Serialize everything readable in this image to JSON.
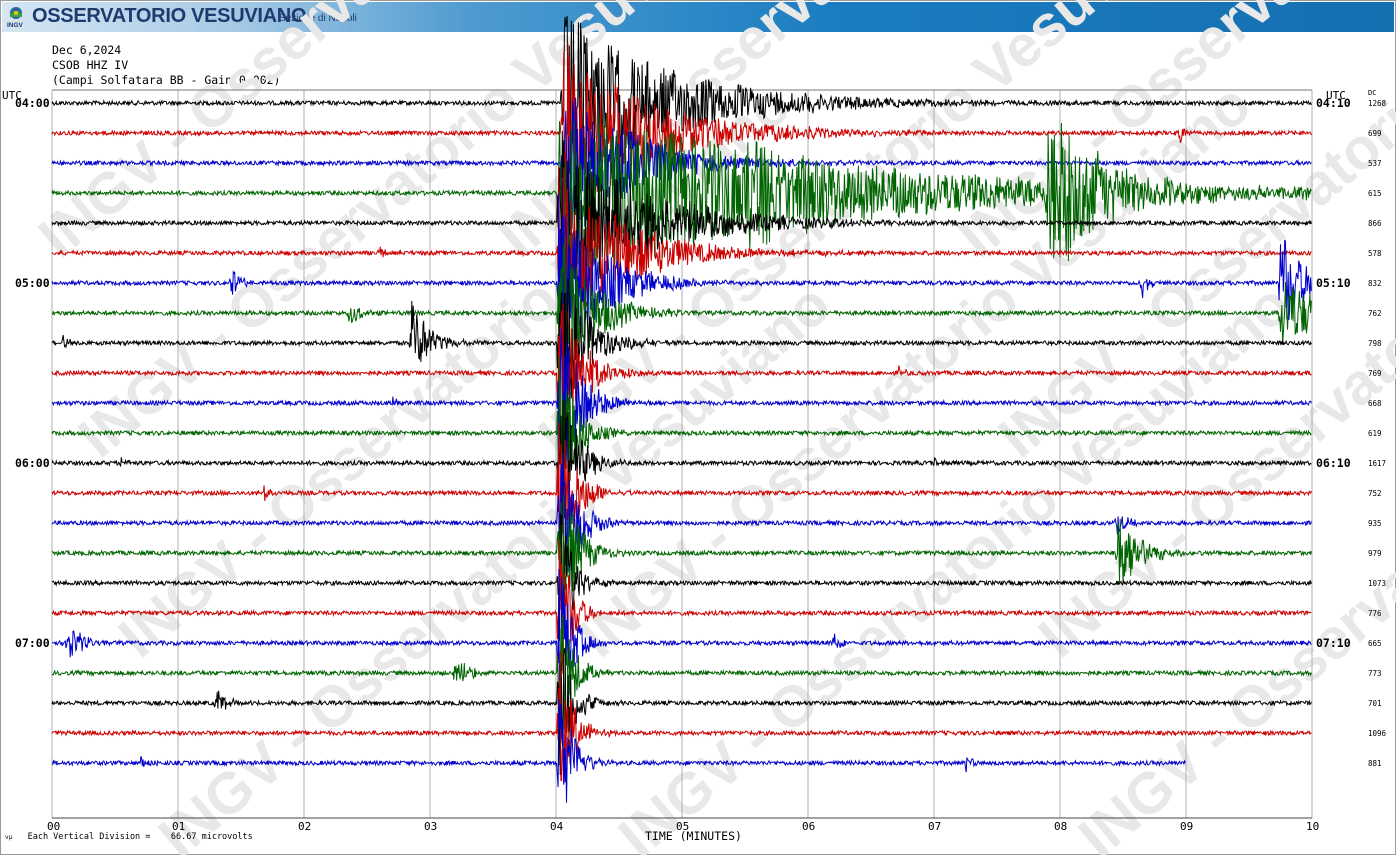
{
  "banner": {
    "title": "OSSERVATORIO VESUVIANO",
    "subtitle": "Sezione di Napoli",
    "logo_text": "INGV"
  },
  "header": {
    "date": "Dec 6,2024",
    "station": "CSOB HHZ IV",
    "description": "(Campi Solfatara BB - Gain 0.002)"
  },
  "watermark": "INGV - Osservatorio Vesuviano",
  "footer": {
    "vertical_division_prefix": "vµ",
    "vertical_division": "Each Vertical Division =    66.67 microvolts"
  },
  "chart_data": {
    "type": "line",
    "title": "",
    "xlabel": "TIME (MINUTES)",
    "x_ticks": [
      "00",
      "01",
      "02",
      "03",
      "04",
      "05",
      "06",
      "07",
      "08",
      "09",
      "10"
    ],
    "xlim": [
      0,
      10
    ],
    "left_axis_title": "UTC",
    "right_axis_title": "UTC",
    "dc_title": "DC",
    "left_time_labels": [
      {
        "line": 0,
        "label": "04:00"
      },
      {
        "line": 6,
        "label": "05:00"
      },
      {
        "line": 12,
        "label": "06:00"
      },
      {
        "line": 18,
        "label": "07:00"
      }
    ],
    "right_time_labels": [
      {
        "line": 0,
        "label": "04:10"
      },
      {
        "line": 6,
        "label": "05:10"
      },
      {
        "line": 12,
        "label": "06:10"
      },
      {
        "line": 18,
        "label": "07:10"
      }
    ],
    "line_minutes": 10,
    "grid": true,
    "colors": [
      "#000000",
      "#cc0000",
      "#0000cc",
      "#006400"
    ],
    "trace_count": 23,
    "last_trace_end_minute": 9.0,
    "dc_offsets": [
      1268,
      699,
      537,
      615,
      866,
      578,
      832,
      762,
      798,
      769,
      668,
      619,
      1617,
      752,
      935,
      979,
      1073,
      776,
      665,
      773,
      701,
      1096,
      881
    ],
    "events": [
      {
        "line": 0,
        "minute": 4.05,
        "amp": 95,
        "decay_s": 50
      },
      {
        "line": 1,
        "minute": 4.05,
        "amp": 95,
        "decay_s": 40
      },
      {
        "line": 2,
        "minute": 4.05,
        "amp": 95,
        "decay_s": 30
      },
      {
        "line": 3,
        "minute": 4.02,
        "amp": 95,
        "decay_s": 120
      },
      {
        "line": 4,
        "minute": 4.02,
        "amp": 95,
        "decay_s": 40
      },
      {
        "line": 5,
        "minute": 4.02,
        "amp": 95,
        "decay_s": 30
      },
      {
        "line": 6,
        "minute": 4.02,
        "amp": 95,
        "decay_s": 20
      },
      {
        "line": 7,
        "minute": 4.02,
        "amp": 95,
        "decay_s": 15
      },
      {
        "line": 8,
        "minute": 4.02,
        "amp": 95,
        "decay_s": 12
      },
      {
        "line": 9,
        "minute": 4.02,
        "amp": 95,
        "decay_s": 10
      },
      {
        "line": 10,
        "minute": 4.02,
        "amp": 95,
        "decay_s": 10
      },
      {
        "line": 11,
        "minute": 4.02,
        "amp": 95,
        "decay_s": 8
      },
      {
        "line": 12,
        "minute": 4.02,
        "amp": 95,
        "decay_s": 8
      },
      {
        "line": 13,
        "minute": 4.02,
        "amp": 95,
        "decay_s": 8
      },
      {
        "line": 14,
        "minute": 4.02,
        "amp": 95,
        "decay_s": 8
      },
      {
        "line": 15,
        "minute": 4.02,
        "amp": 95,
        "decay_s": 8
      },
      {
        "line": 16,
        "minute": 4.02,
        "amp": 95,
        "decay_s": 6
      },
      {
        "line": 17,
        "minute": 4.02,
        "amp": 95,
        "decay_s": 6
      },
      {
        "line": 18,
        "minute": 4.02,
        "amp": 95,
        "decay_s": 6
      },
      {
        "line": 19,
        "minute": 4.02,
        "amp": 95,
        "decay_s": 6
      },
      {
        "line": 20,
        "minute": 4.02,
        "amp": 95,
        "decay_s": 6
      },
      {
        "line": 21,
        "minute": 4.02,
        "amp": 95,
        "decay_s": 6
      },
      {
        "line": 22,
        "minute": 4.02,
        "amp": 95,
        "decay_s": 6
      },
      {
        "line": 3,
        "minute": 5.5,
        "amp": 35,
        "decay_s": 15
      },
      {
        "line": 3,
        "minute": 6.22,
        "amp": 10,
        "decay_s": 5
      },
      {
        "line": 3,
        "minute": 7.9,
        "amp": 95,
        "decay_s": 25
      },
      {
        "line": 1,
        "minute": 8.95,
        "amp": 12,
        "decay_s": 2
      },
      {
        "line": 5,
        "minute": 2.6,
        "amp": 8,
        "decay_s": 2
      },
      {
        "line": 6,
        "minute": 1.42,
        "amp": 20,
        "decay_s": 4
      },
      {
        "line": 6,
        "minute": 8.65,
        "amp": 15,
        "decay_s": 3
      },
      {
        "line": 6,
        "minute": 9.75,
        "amp": 60,
        "decay_s": 10
      },
      {
        "line": 7,
        "minute": 2.35,
        "amp": 15,
        "decay_s": 5
      },
      {
        "line": 7,
        "minute": 9.75,
        "amp": 40,
        "decay_s": 20
      },
      {
        "line": 8,
        "minute": 2.85,
        "amp": 45,
        "decay_s": 8
      },
      {
        "line": 8,
        "minute": 0.08,
        "amp": 8,
        "decay_s": 3
      },
      {
        "line": 9,
        "minute": 6.72,
        "amp": 12,
        "decay_s": 2
      },
      {
        "line": 10,
        "minute": 2.7,
        "amp": 10,
        "decay_s": 3
      },
      {
        "line": 12,
        "minute": 0.55,
        "amp": 8,
        "decay_s": 2
      },
      {
        "line": 12,
        "minute": 6.98,
        "amp": 10,
        "decay_s": 2
      },
      {
        "line": 13,
        "minute": 1.68,
        "amp": 12,
        "decay_s": 2
      },
      {
        "line": 14,
        "minute": 8.45,
        "amp": 15,
        "decay_s": 4
      },
      {
        "line": 15,
        "minute": 8.45,
        "amp": 50,
        "decay_s": 10
      },
      {
        "line": 18,
        "minute": 0.12,
        "amp": 25,
        "decay_s": 6
      },
      {
        "line": 18,
        "minute": 6.2,
        "amp": 15,
        "decay_s": 3
      },
      {
        "line": 19,
        "minute": 3.2,
        "amp": 18,
        "decay_s": 6
      },
      {
        "line": 20,
        "minute": 1.3,
        "amp": 20,
        "decay_s": 4
      },
      {
        "line": 22,
        "minute": 0.7,
        "amp": 10,
        "decay_s": 3
      },
      {
        "line": 22,
        "minute": 7.25,
        "amp": 10,
        "decay_s": 3
      }
    ]
  }
}
